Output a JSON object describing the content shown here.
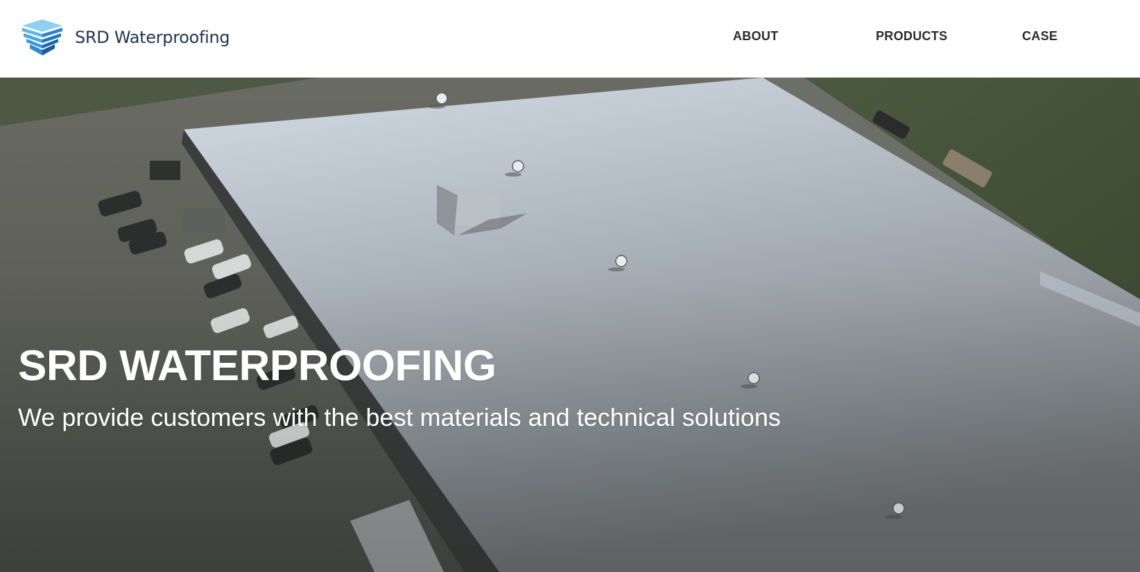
{
  "brand": {
    "name": "SRD Waterproofing",
    "logo_icon": "layered-shield-icon",
    "colors": {
      "logo_light": "#6fc3ee",
      "logo_dark": "#1e76c2",
      "text": "#1f3550"
    }
  },
  "nav": {
    "items": [
      {
        "label": "ABOUT"
      },
      {
        "label": "PRODUCTS"
      },
      {
        "label": "CASE"
      }
    ]
  },
  "hero": {
    "title": "SRD WATERPROOFING",
    "subtitle": "We provide customers with the best materials and technical solutions",
    "image": "aerial-white-roof-photo"
  }
}
